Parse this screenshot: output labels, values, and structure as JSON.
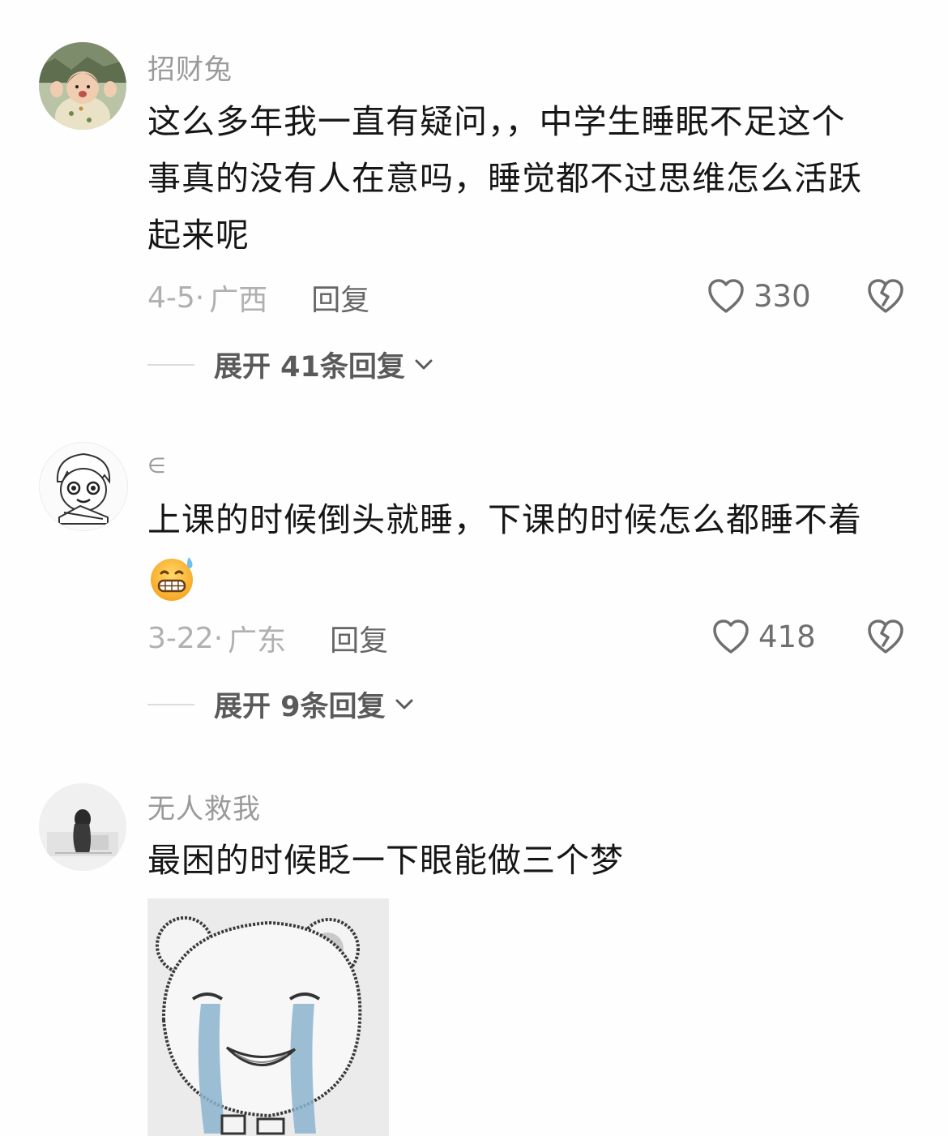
{
  "comments": [
    {
      "username": "招财兔",
      "lines": [
        "这么多年我一直有疑问，，中学生睡眠不足这个",
        "事真的没有人在意吗，睡觉都不过思维怎么活跃",
        "起来呢"
      ],
      "date": "4-5·",
      "location": "广西",
      "reply_label": "回复",
      "likes": "330",
      "expand_label": "展开 41条回复"
    },
    {
      "username": "∈",
      "lines": [
        "上课的时候倒头就睡，下课的时候怎么都睡不着"
      ],
      "emoji": "grinning-sweat-emoji",
      "date": "3-22·",
      "location": "广东",
      "reply_label": "回复",
      "likes": "418",
      "expand_label": "展开 9条回复"
    },
    {
      "username": "无人救我",
      "lines": [
        "最困的时候眨一下眼能做三个梦"
      ],
      "sticker": "crying-bear-sticker"
    }
  ],
  "icons": {
    "like": "heart-outline-icon",
    "dislike": "broken-heart-icon",
    "expand": "chevron-down-icon"
  },
  "colors": {
    "text": "#161616",
    "muted": "#9a9a9a",
    "meta": "#b0b0b0"
  }
}
